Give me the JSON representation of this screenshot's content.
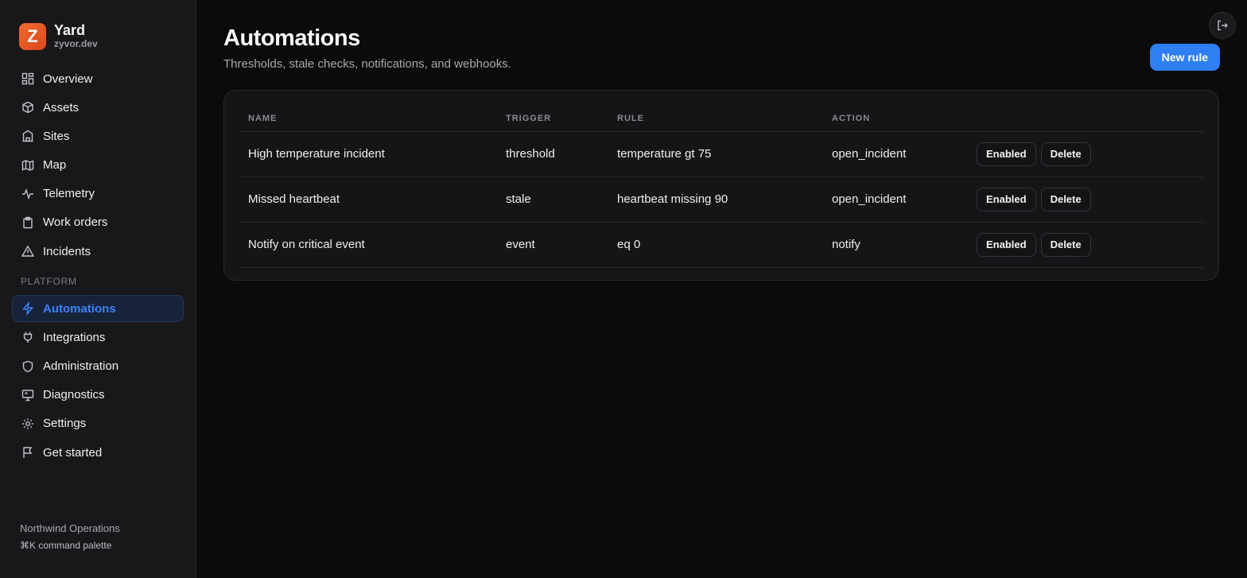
{
  "brand": {
    "logo_letter": "Z",
    "name": "Yard",
    "domain": "zyvor.dev",
    "logo_color": "#e85a25"
  },
  "nav": {
    "items": [
      {
        "label": "Overview",
        "icon": "dashboard-icon"
      },
      {
        "label": "Assets",
        "icon": "cube-icon"
      },
      {
        "label": "Sites",
        "icon": "building-icon"
      },
      {
        "label": "Map",
        "icon": "map-icon"
      },
      {
        "label": "Telemetry",
        "icon": "activity-icon"
      },
      {
        "label": "Work orders",
        "icon": "clipboard-icon"
      },
      {
        "label": "Incidents",
        "icon": "warning-icon"
      }
    ],
    "section_label": "PLATFORM",
    "platform_items": [
      {
        "label": "Automations",
        "icon": "bolt-icon",
        "active": true
      },
      {
        "label": "Integrations",
        "icon": "plug-icon"
      },
      {
        "label": "Administration",
        "icon": "shield-icon"
      },
      {
        "label": "Diagnostics",
        "icon": "monitor-icon"
      },
      {
        "label": "Settings",
        "icon": "gear-icon"
      },
      {
        "label": "Get started",
        "icon": "flag-icon"
      }
    ]
  },
  "footer": {
    "org": "Northwind Operations",
    "hint": "⌘K command palette"
  },
  "header": {
    "title": "Automations",
    "subtitle": "Thresholds, stale checks, notifications, and webhooks.",
    "new_rule_label": "New rule",
    "accent": "#2f7ef2"
  },
  "table": {
    "columns": [
      "NAME",
      "TRIGGER",
      "RULE",
      "ACTION"
    ],
    "rows": [
      {
        "name": "High temperature incident",
        "trigger": "threshold",
        "rule": "temperature gt 75",
        "action": "open_incident",
        "enabled_label": "Enabled",
        "delete_label": "Delete"
      },
      {
        "name": "Missed heartbeat",
        "trigger": "stale",
        "rule": "heartbeat missing 90",
        "action": "open_incident",
        "enabled_label": "Enabled",
        "delete_label": "Delete"
      },
      {
        "name": "Notify on critical event",
        "trigger": "event",
        "rule": "eq 0",
        "action": "notify",
        "enabled_label": "Enabled",
        "delete_label": "Delete"
      }
    ]
  }
}
